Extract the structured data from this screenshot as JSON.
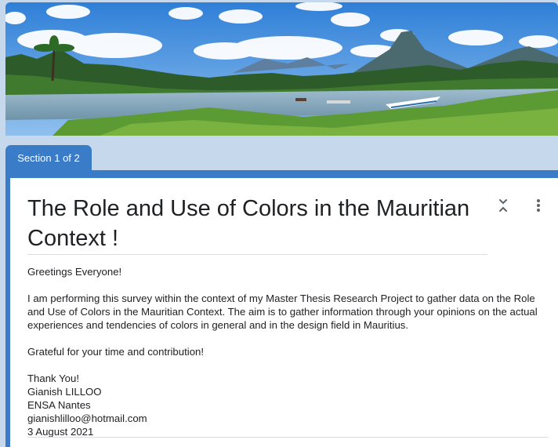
{
  "form": {
    "section_label": "Section 1 of 2",
    "title": "The Role and Use of Colors in the Mauritian Context !",
    "description": {
      "greeting": "Greetings Everyone!",
      "intro": "I am performing this survey within the context of my Master Thesis Research Project to gather data on the Role and Use of Colors in the Mauritian Context. The aim is to gather information through your opinions on the actual experiences and tendencies of colors in general and in the design field in Mauritius.",
      "thanks": "Grateful for your time and contribution!",
      "signoff": "Thank You!",
      "author": "Gianish LILLOO",
      "school": "ENSA Nantes",
      "email": "gianishlilloo@hotmail.com",
      "date": "3 August 2021"
    }
  },
  "icons": {
    "collapse": "collapse-icon",
    "more": "more-vert-icon"
  },
  "colors": {
    "accent": "#3a7cc8",
    "page_background": "#c5d8ec",
    "card_background": "#ffffff",
    "text": "#202124"
  }
}
